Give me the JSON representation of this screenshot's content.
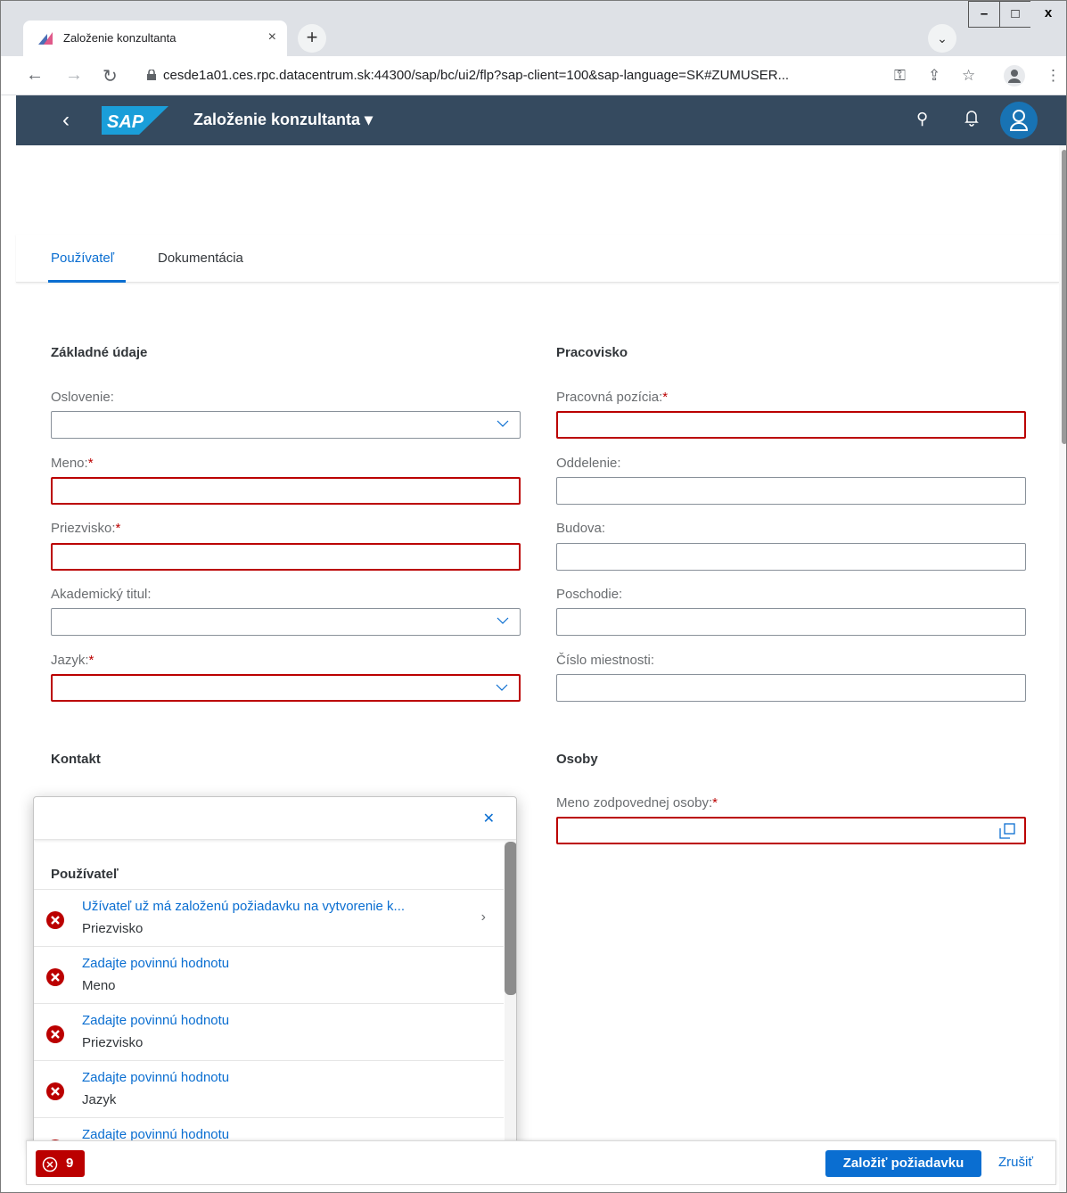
{
  "browser": {
    "tab_title": "Založenie konzultanta",
    "url": "cesde1a01.ces.rpc.datacentrum.sk:44300/sap/bc/ui2/flp?sap-client=100&sap-language=SK#ZUMUSER...",
    "minimize": "–",
    "maximize": "□",
    "close": "x",
    "tab_close": "×",
    "new_tab": "+",
    "tab_search": "⌄"
  },
  "shell": {
    "title": "Založenie konzultanta ▾"
  },
  "tabs": {
    "user": "Používateľ",
    "docs": "Dokumentácia"
  },
  "sections": {
    "basic": "Základné údaje",
    "workplace": "Pracovisko",
    "contact": "Kontakt",
    "persons": "Osoby"
  },
  "fields": {
    "salutation": "Oslovenie:",
    "first_name": "Meno:",
    "last_name": "Priezvisko:",
    "title": "Akademický titul:",
    "language": "Jazyk:",
    "position": "Pracovná pozícia:",
    "department": "Oddelenie:",
    "building": "Budova:",
    "floor": "Poschodie:",
    "room": "Číslo miestnosti:",
    "responsible": "Meno zodpovednej osoby:",
    "required_mark": "*"
  },
  "messages": {
    "group": "Používateľ",
    "items": [
      {
        "title": "Užívateľ už má založenú požiadavku na vytvorenie k...",
        "sub": "Priezvisko"
      },
      {
        "title": "Zadajte povinnú hodnotu",
        "sub": "Meno"
      },
      {
        "title": "Zadajte povinnú hodnotu",
        "sub": "Priezvisko"
      },
      {
        "title": "Zadajte povinnú hodnotu",
        "sub": "Jazyk"
      },
      {
        "title": "Zadajte povinnú hodnotu",
        "sub": ""
      }
    ]
  },
  "footer": {
    "error_count": "9",
    "submit": "Založiť požiadavku",
    "cancel": "Zrušiť"
  },
  "colors": {
    "shell": "#354a5f",
    "accent": "#0a6ed1",
    "error": "#bb0000"
  }
}
